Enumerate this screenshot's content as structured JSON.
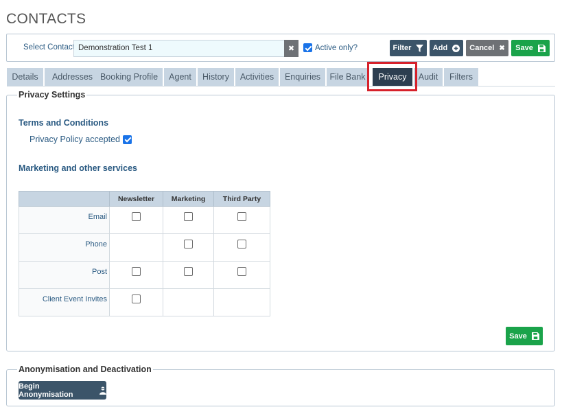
{
  "page": {
    "title": "CONTACTS"
  },
  "toolbar": {
    "select_contact_label": "Select Contact",
    "contact_value": "Demonstration Test 1",
    "active_only_label": "Active only?",
    "active_only_checked": true,
    "filter_label": "Filter",
    "add_label": "Add",
    "cancel_label": "Cancel",
    "save_label": "Save"
  },
  "tabs": [
    {
      "label": "Details"
    },
    {
      "label": "Addresses"
    },
    {
      "label": "Booking Profile"
    },
    {
      "label": "Agent"
    },
    {
      "label": "History"
    },
    {
      "label": "Activities"
    },
    {
      "label": "Enquiries"
    },
    {
      "label": "File Bank"
    },
    {
      "label": "Privacy",
      "active": true
    },
    {
      "label": "Audit"
    },
    {
      "label": "Filters"
    }
  ],
  "privacy": {
    "legend": "Privacy Settings",
    "terms_heading": "Terms and Conditions",
    "privacy_policy_label": "Privacy Policy accepted",
    "privacy_policy_checked": true,
    "marketing_heading": "Marketing and other services",
    "table": {
      "columns": [
        "Newsletter",
        "Marketing",
        "Third Party"
      ],
      "rows": [
        {
          "label": "Email",
          "options": [
            true,
            true,
            true
          ]
        },
        {
          "label": "Phone",
          "options": [
            false,
            true,
            true
          ]
        },
        {
          "label": "Post",
          "options": [
            true,
            true,
            true
          ]
        },
        {
          "label": "Client Event Invites",
          "options": [
            true,
            false,
            false
          ]
        }
      ]
    },
    "save_label": "Save"
  },
  "anonymisation": {
    "legend": "Anonymisation and Deactivation",
    "button_label": "Begin Anonymisation"
  },
  "colors": {
    "primary_button": "#3b5469",
    "save_button": "#1aa34a",
    "cancel_button": "#6e7175",
    "tab_inactive": "#c7d5e2",
    "tab_active": "#2c3e50",
    "highlight": "#d6212b"
  }
}
